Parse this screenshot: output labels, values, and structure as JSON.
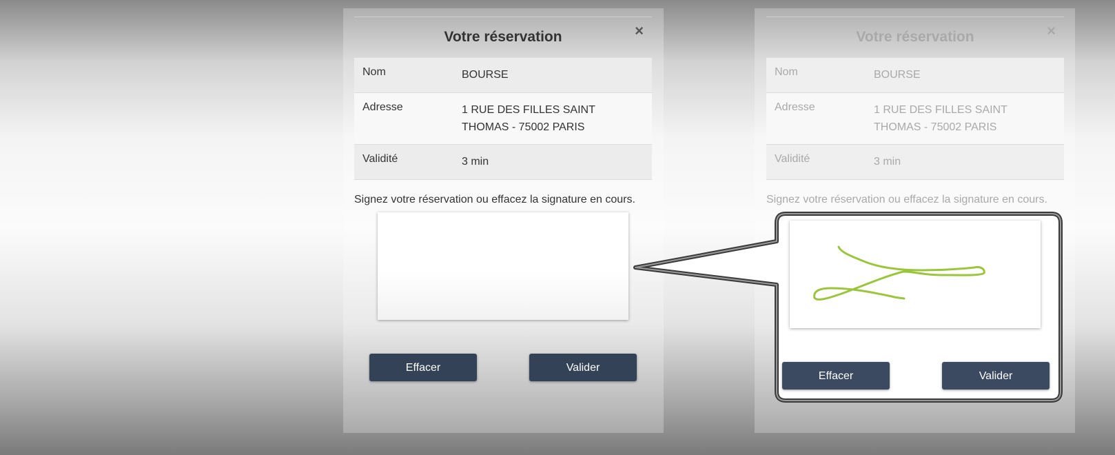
{
  "dialog": {
    "title": "Votre réservation",
    "close": "×",
    "rows": [
      {
        "label": "Nom",
        "value": "BOURSE"
      },
      {
        "label": "Adresse",
        "value_line1": "1 RUE DES FILLES SAINT",
        "value_line2": "THOMAS - 75002 PARIS"
      },
      {
        "label": "Validité",
        "value": "3 min"
      }
    ],
    "instruction": "Signez votre réservation ou effacez la signature en cours.",
    "buttons": {
      "clear": "Effacer",
      "validate": "Valider"
    }
  },
  "colors": {
    "button": "#334257",
    "signature_stroke": "#9bc53d",
    "callout_border": "#3a3a3a"
  }
}
